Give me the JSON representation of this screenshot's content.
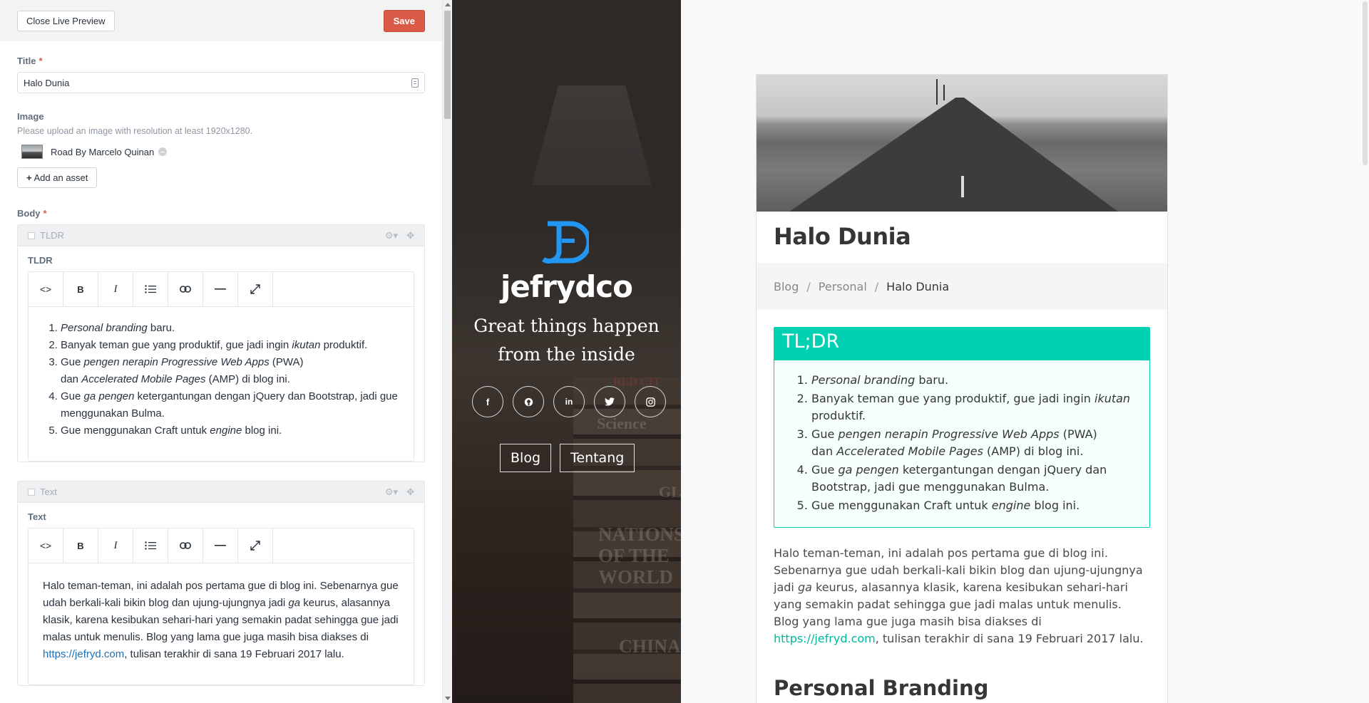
{
  "header": {
    "close_label": "Close Live Preview",
    "save_label": "Save"
  },
  "fields": {
    "title_label": "Title",
    "required_mark": "*",
    "title_value": "Halo Dunia",
    "image_label": "Image",
    "image_instructions": "Please upload an image with resolution at least 1920x1280.",
    "asset_name": "Road By Marcelo Quinan",
    "add_asset_label": "Add an asset",
    "body_label": "Body"
  },
  "blocks": [
    {
      "type_label": "TLDR",
      "field_label": "TLDR"
    },
    {
      "type_label": "Text",
      "field_label": "Text"
    }
  ],
  "toolbar": {
    "html": "<>",
    "bold": "B",
    "italic": "I",
    "list": "☰",
    "link": "🔗",
    "hr": "—",
    "fullscreen": "⤢"
  },
  "tldr_items": [
    {
      "em": "Personal branding",
      "text": " baru."
    },
    {
      "pre": "Banyak teman gue yang produktif, gue jadi ingin ",
      "em": "ikutan",
      "text": " produktif."
    },
    {
      "pre": "Gue ",
      "em": "pengen nerapin Progressive Web Apps",
      "text": " (PWA)",
      "line2_pre": "dan ",
      "line2_em": "Accelerated Mobile Pages",
      "line2_text": " (AMP) di blog ini."
    },
    {
      "pre": "Gue ",
      "em": "ga pengen",
      "text": " ketergantungan dengan jQuery dan Bootstrap, jadi gue menggunakan Bulma."
    },
    {
      "pre": "Gue menggunakan Craft untuk ",
      "em": "engine",
      "text": " blog ini."
    }
  ],
  "text_body": {
    "p1": "Halo teman-teman, ini adalah pos pertama gue di blog ini. Sebenarnya gue udah berkali-kali bikin blog dan ujung-ujungnya jadi ",
    "em": "ga",
    "p2": " keurus, alasannya klasik, karena kesibukan sehari-hari yang semakin padat sehingga gue jadi malas untuk menulis. Blog yang lama gue juga masih bisa diakses di ",
    "link": "https://jefryd.com",
    "p3": ", tulisan terakhir di sana 19 Februari 2017 lalu."
  },
  "hero": {
    "brand": "jefrydco",
    "tagline": "Great things happen from the inside",
    "socials": [
      "f",
      "gh",
      "in",
      "tw",
      "ig"
    ],
    "nav": [
      "Blog",
      "Tentang"
    ]
  },
  "article": {
    "title": "Halo Dunia",
    "breadcrumb": [
      "Blog",
      "Personal",
      "Halo Dunia"
    ],
    "breadcrumb_sep": "/",
    "tldr_heading": "TL;DR",
    "section_heading": "Personal Branding"
  },
  "colors": {
    "save": "#da5a47",
    "accent": "#00d1b2",
    "logo_blue": "#2196f3",
    "link": "#1f6fb5"
  }
}
